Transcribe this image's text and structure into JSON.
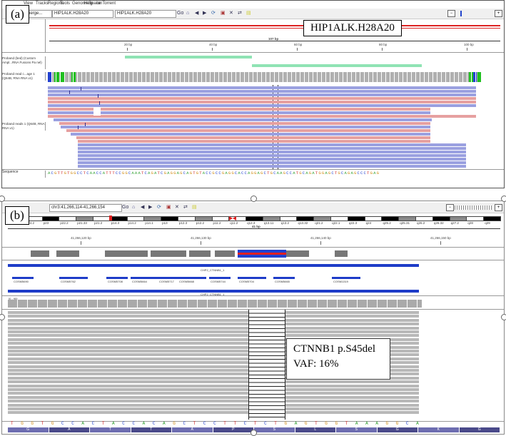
{
  "panel_a": {
    "label": "(a)",
    "menu": [
      "View",
      "Tracks",
      "Regions",
      "Tools",
      "GenomeSpace",
      "Help",
      "IonTorrent"
    ],
    "genome_select": "_merge...",
    "locus_select": "HIP1ALK.H28A20",
    "locus_input": "HIP1ALK.H28A20",
    "go_label": "Go",
    "callout": "HIP1ALK.H28A20",
    "span_label": "107 bp",
    "ruler_ticks": [
      "20 bp",
      "40 bp",
      "60 bp",
      "80 bp",
      "100 bp"
    ],
    "track_names": {
      "bed": "Proband (bed)\n(Custom Ampl...RNA Fusions Pa\nnel)",
      "coverage": "Proband read c...age 1\n(Q64B, RNA RNA v1)",
      "reads": "Proband reads 1\n(Q64B, RNA RNA v1)",
      "sequence": "Sequence"
    },
    "sequence": "ACGTTGTGGCCTCAACCATTTCCGGCAAATCAGATCGAGGAGCAGTGTACCGCCGAGGCACCAGGAGCTGCAAGCCATGCAGATGGAGCTGCAGAGCCCTGAG"
  },
  "panel_b": {
    "label": "(b)",
    "locus_input": "chr3:41,266,114-41,266,154",
    "go_label": "Go",
    "callout_line1": "CTNNB1 p.S45del",
    "callout_line2": "VAF: 16%",
    "span_label": "41 bp",
    "ruler_ticks": [
      "41,266,120 bp",
      "41,266,130 bp",
      "41,266,140 bp",
      "41,266,150 bp"
    ],
    "bands": [
      "p24.3",
      "p24.2",
      "p23",
      "p22.2",
      "p21.33",
      "p21.2",
      "p14.3",
      "p14.2",
      "p14.1",
      "p13",
      "p12.3",
      "p12.2",
      "p11.2",
      "q11.2",
      "q12.3",
      "q13.11",
      "q13.2",
      "q13.32",
      "q21.2",
      "q22.1",
      "q22.3",
      "q24",
      "q25.2",
      "q25.31",
      "q26.2",
      "q26.32",
      "q27.2",
      "q28",
      "q29"
    ],
    "gene_labels": [
      "CHP2_CTNNB1_1",
      "CHP2_CTNNB1_1"
    ],
    "cosmic_ids": [
      "COSM5690",
      "COSM5762",
      "COSM5708",
      "COSM5664",
      "COSM5717",
      "COSM5668",
      "COSM5744",
      "COSM5704",
      "COSM5665",
      "COSM1319"
    ],
    "coverage_label": "[0 - 95]",
    "sequence": "TGGTGCCACTACCACAGCTCCTTCTCTGAGTGGTAAAGGCA",
    "aa_track": [
      "G",
      "A",
      "T",
      "T",
      "A",
      "P",
      "S",
      "L",
      "S",
      "G",
      "K",
      "G"
    ]
  },
  "colors": {
    "blue_read": "#9aa0e0",
    "pink_read": "#e6a0a0",
    "green_bed": "#8fe3b4",
    "gene_blue": "#1e3cc8",
    "cytoband_red": "#e02020"
  }
}
